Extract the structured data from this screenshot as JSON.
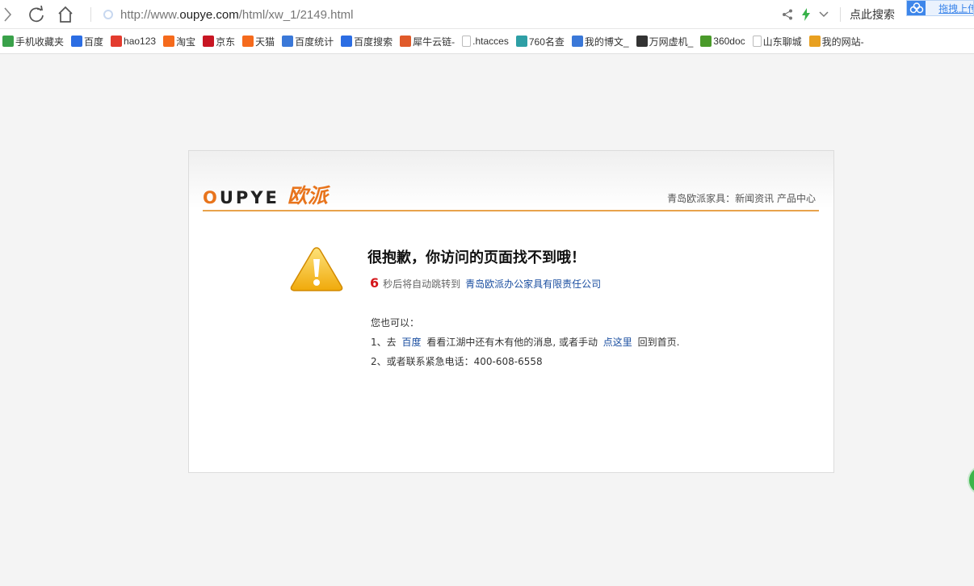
{
  "toolbar": {
    "url_prefix": "http://www.",
    "url_domain": "oupye.com",
    "url_path": "/html/xw_1/2149.html",
    "search_label": "点此搜索",
    "ext_label": "拖拽上传"
  },
  "bookmarks": [
    {
      "label": "手机收藏夹",
      "icon": "phone-icon",
      "color": "#3aa14a"
    },
    {
      "label": "百度",
      "icon": "baidu-paw-icon",
      "color": "#2b6de3"
    },
    {
      "label": "hao123",
      "icon": "hao123-icon",
      "color": "#e33b2e"
    },
    {
      "label": "淘宝",
      "icon": "taobao-icon",
      "color": "#f56a1c"
    },
    {
      "label": "京东",
      "icon": "jd-icon",
      "color": "#c81623"
    },
    {
      "label": "天猫",
      "icon": "tmall-icon",
      "color": "#f56a1c"
    },
    {
      "label": "百度统计",
      "icon": "stats-icon",
      "color": "#3a78d8"
    },
    {
      "label": "百度搜索",
      "icon": "baidu-paw-icon",
      "color": "#2b6de3"
    },
    {
      "label": "犀牛云链-",
      "icon": "rhino-icon",
      "color": "#e05a2a"
    },
    {
      "label": ".htacces",
      "icon": "page-icon",
      "color": "#cccccc"
    },
    {
      "label": "760名查",
      "icon": "crop-icon",
      "color": "#2e9fa5"
    },
    {
      "label": "我的博文_",
      "icon": "globe-icon",
      "color": "#3a78d8"
    },
    {
      "label": "万网虚机_",
      "icon": "brackets-icon",
      "color": "#333333"
    },
    {
      "label": "360doc",
      "icon": "doc360-icon",
      "color": "#4a9a2a"
    },
    {
      "label": "山东聊城",
      "icon": "page-icon",
      "color": "#cccccc"
    },
    {
      "label": "我的网站-",
      "icon": "layers-icon",
      "color": "#e8a020"
    }
  ],
  "header": {
    "logo_latin": "OUPYE",
    "logo_cn": "欧派",
    "breadcrumb": "青岛欧派家具：新闻资讯 产品中心"
  },
  "message": {
    "title": "很抱歉，你访问的页面找不到哦！",
    "countdown": "6",
    "redirect_text": "秒后将自动跳转到",
    "redirect_link": "青岛欧派办公家具有限责任公司",
    "hint": "您也可以：",
    "opt1_prefix": "1、去",
    "opt1_link1": "百度",
    "opt1_middle": "看看江湖中还有木有他的消息, 或者手动",
    "opt1_link2": "点这里",
    "opt1_suffix": "回到首页.",
    "opt2": "2、或者联系紧急电话：400-608-6558"
  },
  "colors": {
    "accent": "#e8741c",
    "link": "#1a4ea0",
    "countdown": "#d4161b",
    "rule": "#e8a34c"
  }
}
